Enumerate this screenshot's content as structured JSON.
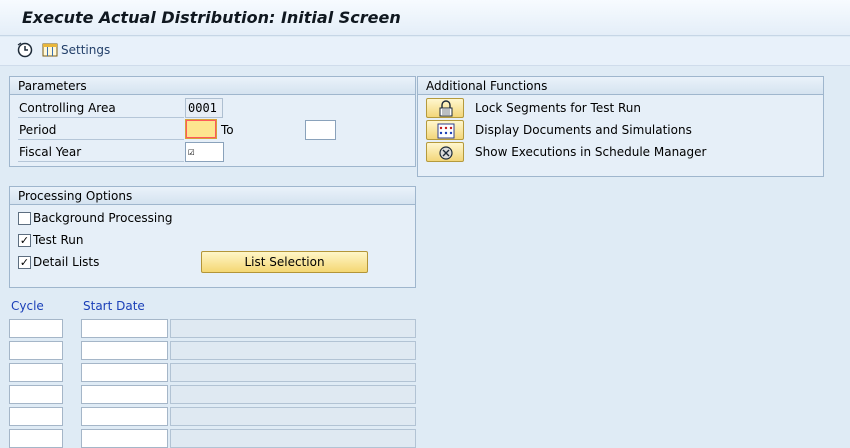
{
  "title": "Execute Actual Distribution: Initial Screen",
  "toolbar": {
    "settings_label": "Settings"
  },
  "parameters": {
    "header": "Parameters",
    "controlling_area_label": "Controlling Area",
    "controlling_area_value": "0001",
    "period_label": "Period",
    "period_to_label": "To",
    "fiscal_year_label": "Fiscal Year",
    "fiscal_year_value": "☑"
  },
  "additional_functions": {
    "header": "Additional Functions",
    "items": [
      {
        "label": "Lock Segments for Test Run",
        "icon": "lock-icon"
      },
      {
        "label": "Display Documents and Simulations",
        "icon": "documents-icon"
      },
      {
        "label": "Show Executions in Schedule Manager",
        "icon": "schedule-manager-icon"
      }
    ]
  },
  "processing_options": {
    "header": "Processing Options",
    "background_processing": {
      "label": "Background Processing",
      "checked": false
    },
    "test_run": {
      "label": "Test Run",
      "checked": true
    },
    "detail_lists": {
      "label": "Detail Lists",
      "checked": true
    },
    "list_selection_label": "List Selection"
  },
  "cycle_table": {
    "headers": {
      "cycle": "Cycle",
      "start_date": "Start Date"
    },
    "row_count": 6
  },
  "colors": {
    "background": "#dfebf5",
    "button": "#f4d774",
    "column_header": "#1a3fb8"
  }
}
